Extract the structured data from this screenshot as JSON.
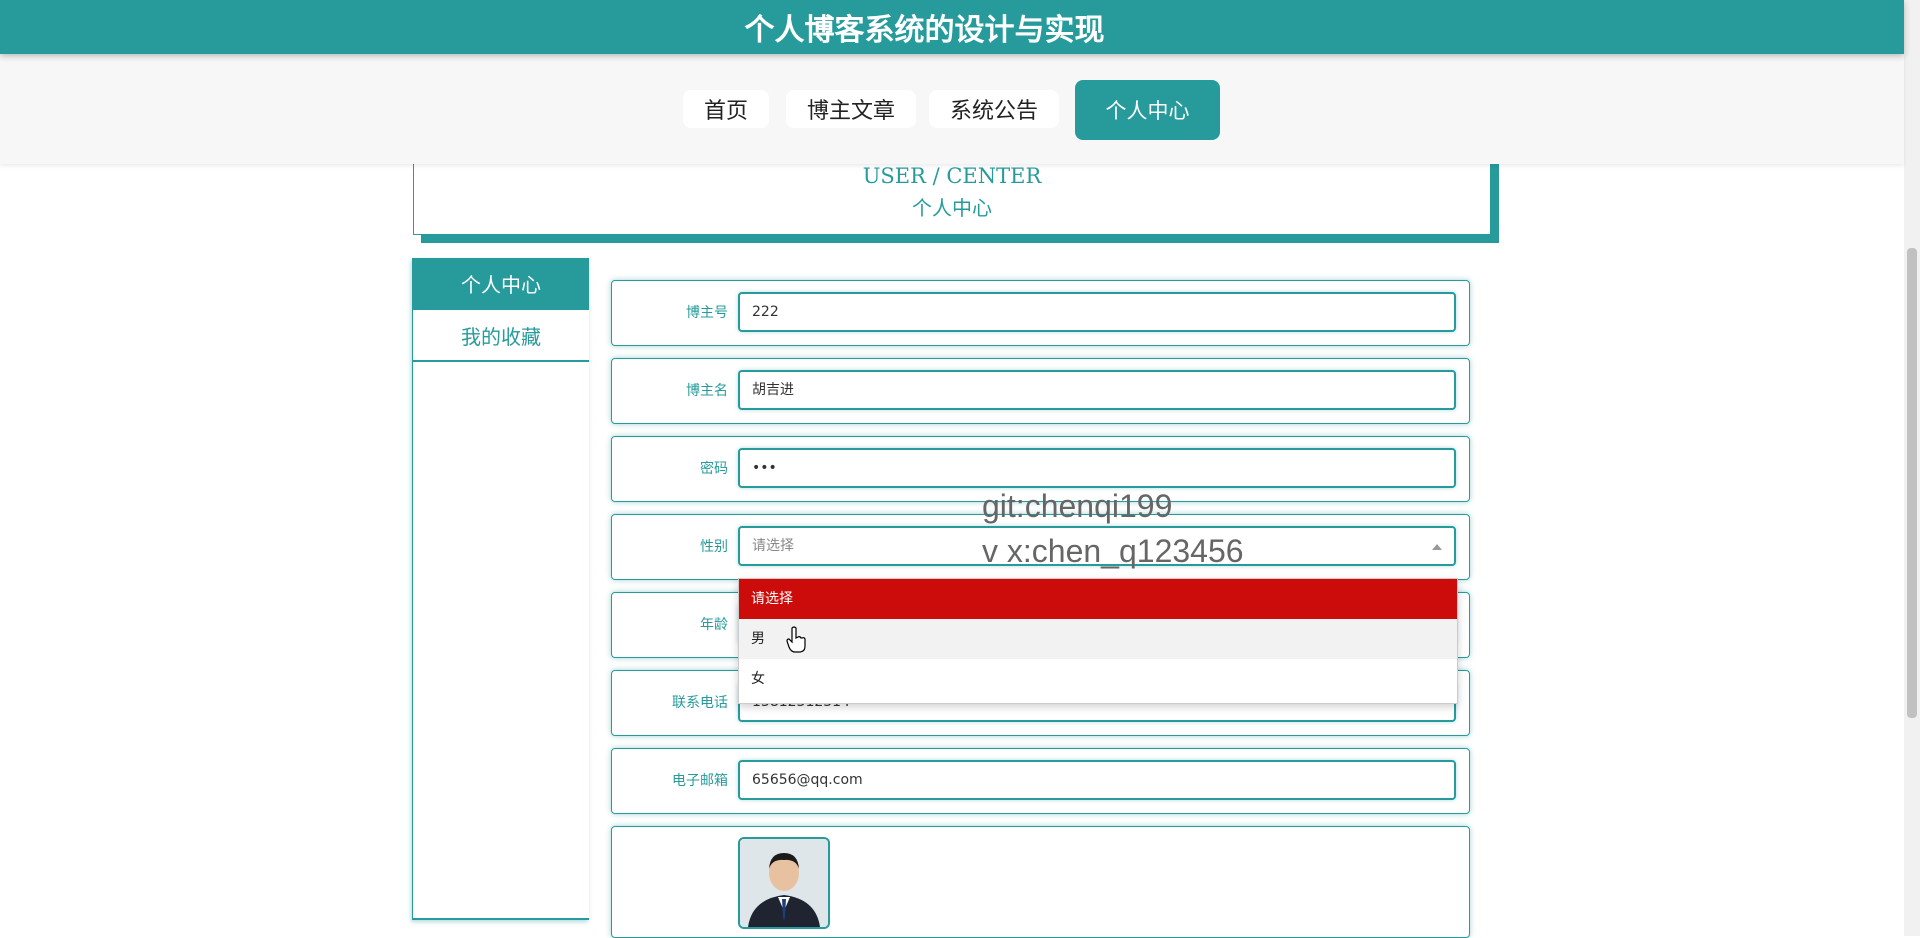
{
  "header": {
    "title": "个人博客系统的设计与实现"
  },
  "nav": {
    "items": [
      "首页",
      "博主文章",
      "系统公告",
      "个人中心"
    ],
    "active_index": 3
  },
  "banner": {
    "title_en": "USER / CENTER",
    "title_cn": "个人中心"
  },
  "sidebar": {
    "items": [
      "个人中心",
      "我的收藏"
    ],
    "active_index": 0
  },
  "form": {
    "fields": [
      {
        "label": "博主号",
        "value": "222"
      },
      {
        "label": "博主名",
        "value": "胡吉进"
      },
      {
        "label": "密码",
        "value": "•••"
      },
      {
        "label": "性别",
        "value": "请选择"
      },
      {
        "label": "年龄",
        "value": ""
      },
      {
        "label": "联系电话",
        "value": "13812312314"
      },
      {
        "label": "电子邮箱",
        "value": "65656@qq.com"
      }
    ],
    "gender_dropdown": {
      "options": [
        "请选择",
        "男",
        "女"
      ],
      "selected_index": 0,
      "hover_index": 1
    }
  },
  "watermark": {
    "line1": "git:chenqi199",
    "line2": "v x:chen_q123456"
  },
  "colors": {
    "primary": "#279b9c",
    "selected_option": "#cc0b0b"
  },
  "icons": {
    "dropdown_caret": "caret-up-icon",
    "cursor": "hand-pointer-icon"
  }
}
